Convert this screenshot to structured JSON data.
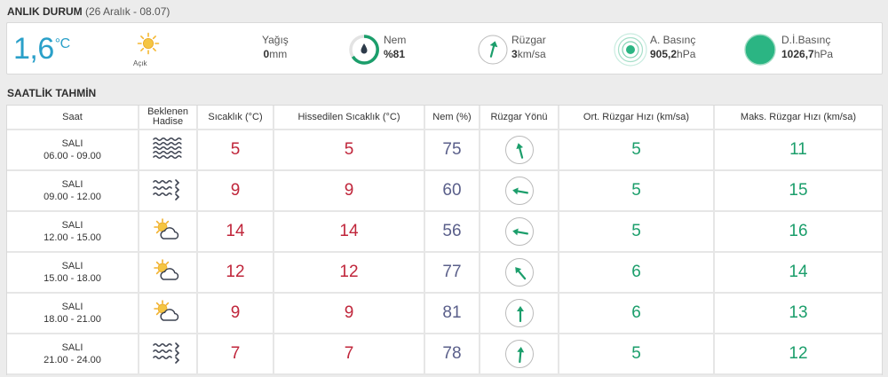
{
  "current": {
    "title": "ANLIK DURUM",
    "subtitle": "(26 Aralık - 08.07)",
    "temperature": "1,6",
    "temp_unit": "°C",
    "condition": "Açık",
    "precip_label": "Yağış",
    "precip_value": "0",
    "precip_unit": "mm",
    "humidity_label": "Nem",
    "humidity_value": "%81",
    "wind_label": "Rüzgar",
    "wind_value": "3",
    "wind_unit": "km/sa",
    "pressure_label": "A. Basınç",
    "pressure_value": "905,2",
    "pressure_unit": "hPa",
    "sea_pressure_label": "D.İ.Basınç",
    "sea_pressure_value": "1026,7",
    "sea_pressure_unit": "hPa"
  },
  "forecast": {
    "title": "SAATLİK TAHMİN",
    "headers": {
      "time": "Saat",
      "event_line1": "Beklenen",
      "event_line2": "Hadise",
      "temp": "Sıcaklık (°C)",
      "feels": "Hissedilen Sıcaklık (°C)",
      "humidity": "Nem (%)",
      "wind_dir": "Rüzgar Yönü",
      "avg_wind": "Ort. Rüzgar Hızı (km/sa)",
      "max_wind": "Maks. Rüzgar Hızı (km/sa)"
    },
    "rows": [
      {
        "day": "SALI",
        "range": "06.00 - 09.00",
        "icon": "fog-icon",
        "temp": "5",
        "feels": "5",
        "humidity": "75",
        "wind_dir_deg": 345,
        "avg": "5",
        "max": "11"
      },
      {
        "day": "SALI",
        "range": "09.00 - 12.00",
        "icon": "fog-rain-icon",
        "temp": "9",
        "feels": "9",
        "humidity": "60",
        "wind_dir_deg": 280,
        "avg": "5",
        "max": "15"
      },
      {
        "day": "SALI",
        "range": "12.00 - 15.00",
        "icon": "partly-cloudy-icon",
        "temp": "14",
        "feels": "14",
        "humidity": "56",
        "wind_dir_deg": 280,
        "avg": "5",
        "max": "16"
      },
      {
        "day": "SALI",
        "range": "15.00 - 18.00",
        "icon": "partly-cloudy-icon",
        "temp": "12",
        "feels": "12",
        "humidity": "77",
        "wind_dir_deg": 320,
        "avg": "6",
        "max": "14"
      },
      {
        "day": "SALI",
        "range": "18.00 - 21.00",
        "icon": "partly-cloudy-icon",
        "temp": "9",
        "feels": "9",
        "humidity": "81",
        "wind_dir_deg": 0,
        "avg": "6",
        "max": "13"
      },
      {
        "day": "SALI",
        "range": "21.00 - 24.00",
        "icon": "fog-rain-icon",
        "temp": "7",
        "feels": "7",
        "humidity": "78",
        "wind_dir_deg": 5,
        "avg": "5",
        "max": "12"
      }
    ]
  },
  "colors": {
    "accent": "#2aa0c9",
    "temperature": "#c0263b",
    "humidity": "#5a5f8a",
    "wind": "#1b9e6b"
  }
}
